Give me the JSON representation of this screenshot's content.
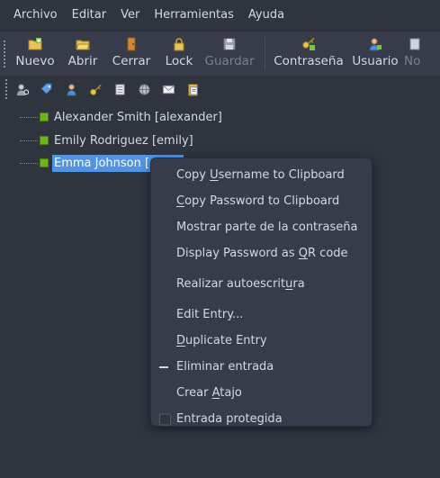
{
  "menubar": {
    "items": [
      "Archivo",
      "Editar",
      "Ver",
      "Herramientas",
      "Ayuda"
    ]
  },
  "toolbar": {
    "buttons": [
      {
        "label": "Nuevo",
        "icon": "new-folder-icon",
        "enabled": true
      },
      {
        "label": "Abrir",
        "icon": "open-folder-icon",
        "enabled": true
      },
      {
        "label": "Cerrar",
        "icon": "close-door-icon",
        "enabled": true
      },
      {
        "label": "Lock",
        "icon": "lock-icon",
        "enabled": true
      },
      {
        "label": "Guardar",
        "icon": "save-disk-icon",
        "enabled": false
      },
      {
        "label": "Contraseña",
        "icon": "key-icon",
        "enabled": true
      },
      {
        "label": "Usuario",
        "icon": "user-icon",
        "enabled": true
      },
      {
        "label": "No",
        "icon": "notes-icon",
        "enabled": true
      }
    ]
  },
  "toolbar2": {
    "icons": [
      "search-user-icon",
      "tag-icon",
      "user-icon",
      "key-icon",
      "list-icon",
      "globe-icon",
      "mail-icon",
      "paste-icon"
    ]
  },
  "tree": {
    "entries": [
      {
        "label": "Alexander Smith [alexander]",
        "selected": false
      },
      {
        "label": "Emily Rodriguez [emily]",
        "selected": false
      },
      {
        "label": "Emma Johnson [em",
        "selected": true
      }
    ]
  },
  "context_menu": {
    "items": [
      {
        "pre": "Copy ",
        "u": "U",
        "post": "sername to Clipboard"
      },
      {
        "pre": "",
        "u": "C",
        "post": "opy Password to Clipboard"
      },
      {
        "pre": "Mostrar parte de la contraseña",
        "u": "",
        "post": ""
      },
      {
        "pre": "Display Password as ",
        "u": "Q",
        "post": "R code"
      },
      {
        "pre": "Realizar autoescrit",
        "u": "u",
        "post": "ra"
      },
      {
        "pre": "Edit Entry...",
        "u": "",
        "post": ""
      },
      {
        "pre": "",
        "u": "D",
        "post": "uplicate Entry"
      },
      {
        "pre": "Eliminar entrada",
        "u": "",
        "post": ""
      },
      {
        "pre": "Crear ",
        "u": "A",
        "post": "tajo"
      },
      {
        "pre": "Entrada protegida",
        "u": "",
        "post": ""
      }
    ]
  },
  "colors": {
    "background": "#2f343f",
    "toolbar": "#383c4a",
    "selection": "#5294e2",
    "entry_icon": "#6fb31c"
  }
}
